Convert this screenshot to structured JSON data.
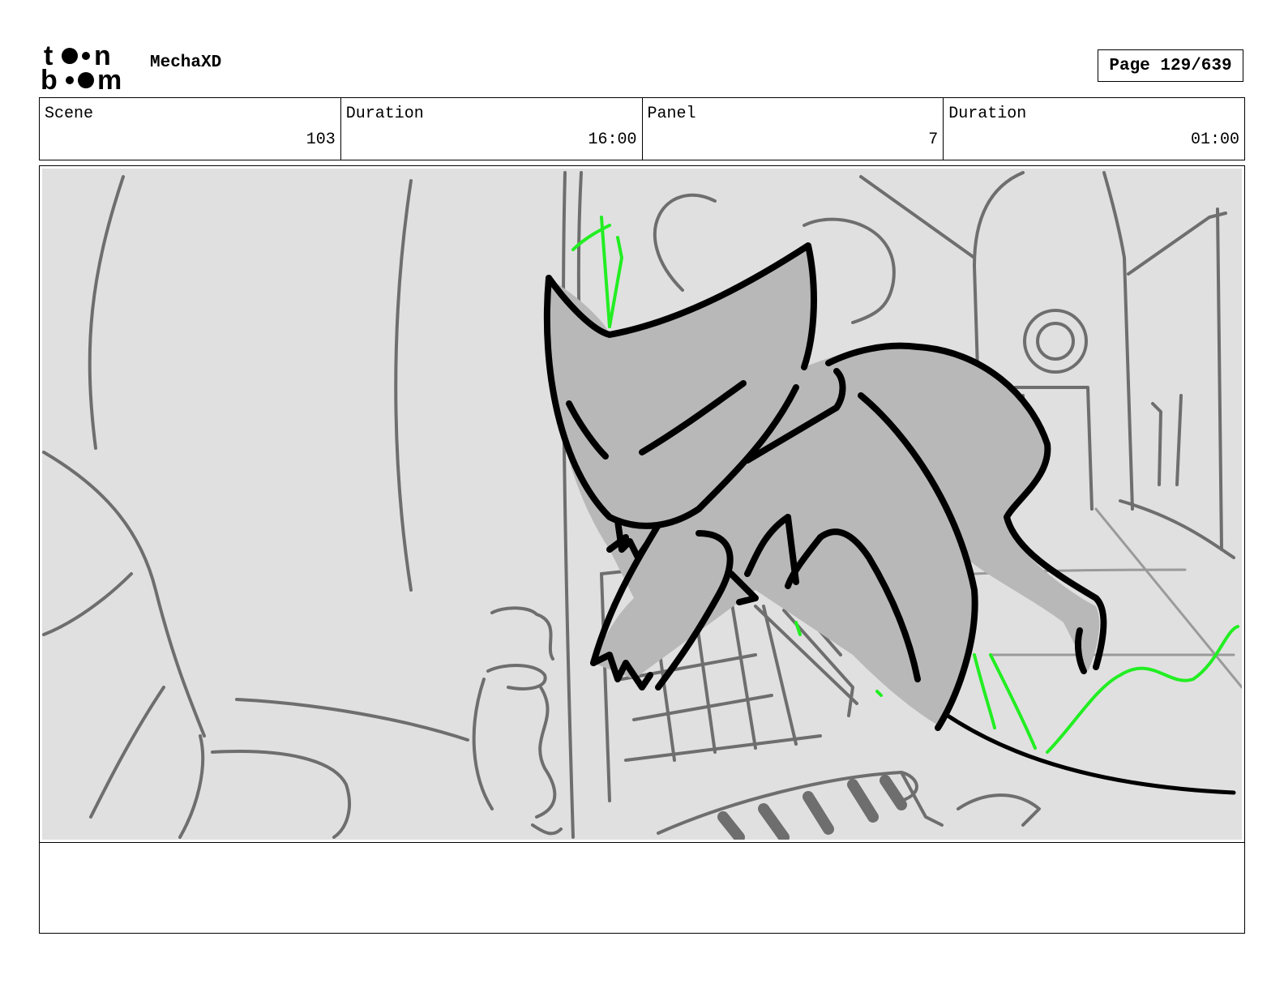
{
  "header": {
    "logo_text": "toon boom",
    "project_title": "MechaXD",
    "page_label": "Page 129/639"
  },
  "info": {
    "scene_label": "Scene",
    "scene_value": "103",
    "scene_duration_label": "Duration",
    "scene_duration_value": "16:00",
    "panel_label": "Panel",
    "panel_value": "7",
    "panel_duration_label": "Duration",
    "panel_duration_value": "01:00"
  },
  "notes": {
    "text": ""
  },
  "colors": {
    "panel_background": "#e0e0e0",
    "sketch_gray": "#6e6e6e",
    "ink_black": "#000000",
    "character_fill": "#b8b8b8",
    "motion_green": "#22ee22"
  }
}
